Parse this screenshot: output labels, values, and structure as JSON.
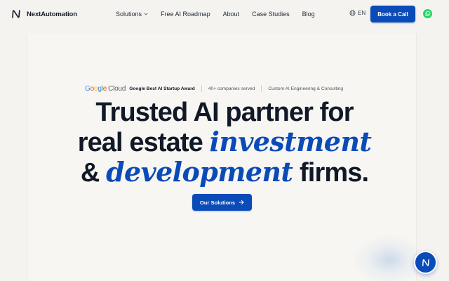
{
  "brand": {
    "name": "NextAutomation",
    "logo_icon": "n-logo-icon"
  },
  "nav": {
    "items": [
      {
        "label": "Solutions",
        "has_dropdown": true
      },
      {
        "label": "Free AI Roadmap"
      },
      {
        "label": "About"
      },
      {
        "label": "Case Studies"
      },
      {
        "label": "Blog"
      }
    ]
  },
  "language": {
    "label": "EN",
    "icon": "globe-icon"
  },
  "header_cta": {
    "label": "Book a Call"
  },
  "whatsapp": {
    "icon": "whatsapp-icon",
    "color": "#25d366"
  },
  "badges": {
    "google": "Google",
    "cloud": "Cloud",
    "award": "Google Best AI Startup Award",
    "companies": "40+ companies served",
    "service": "Custom AI Engineering & Consulting"
  },
  "headline": {
    "line1": "Trusted AI partner for",
    "line2_prefix": "real estate ",
    "line2_accent": "investment",
    "line3_prefix": "& ",
    "line3_accent": "development",
    "line3_suffix": " firms."
  },
  "hero_cta": {
    "label": "Our Solutions",
    "icon": "arrow-right-icon"
  },
  "chat_widget": {
    "icon": "n-logo-icon"
  },
  "colors": {
    "accent": "#0b4bb8",
    "background": "#f5f3ef",
    "text": "#111827",
    "google_blue": "#4285f4",
    "google_red": "#ea4335",
    "google_yellow": "#fbbc05",
    "google_green": "#34a853"
  }
}
